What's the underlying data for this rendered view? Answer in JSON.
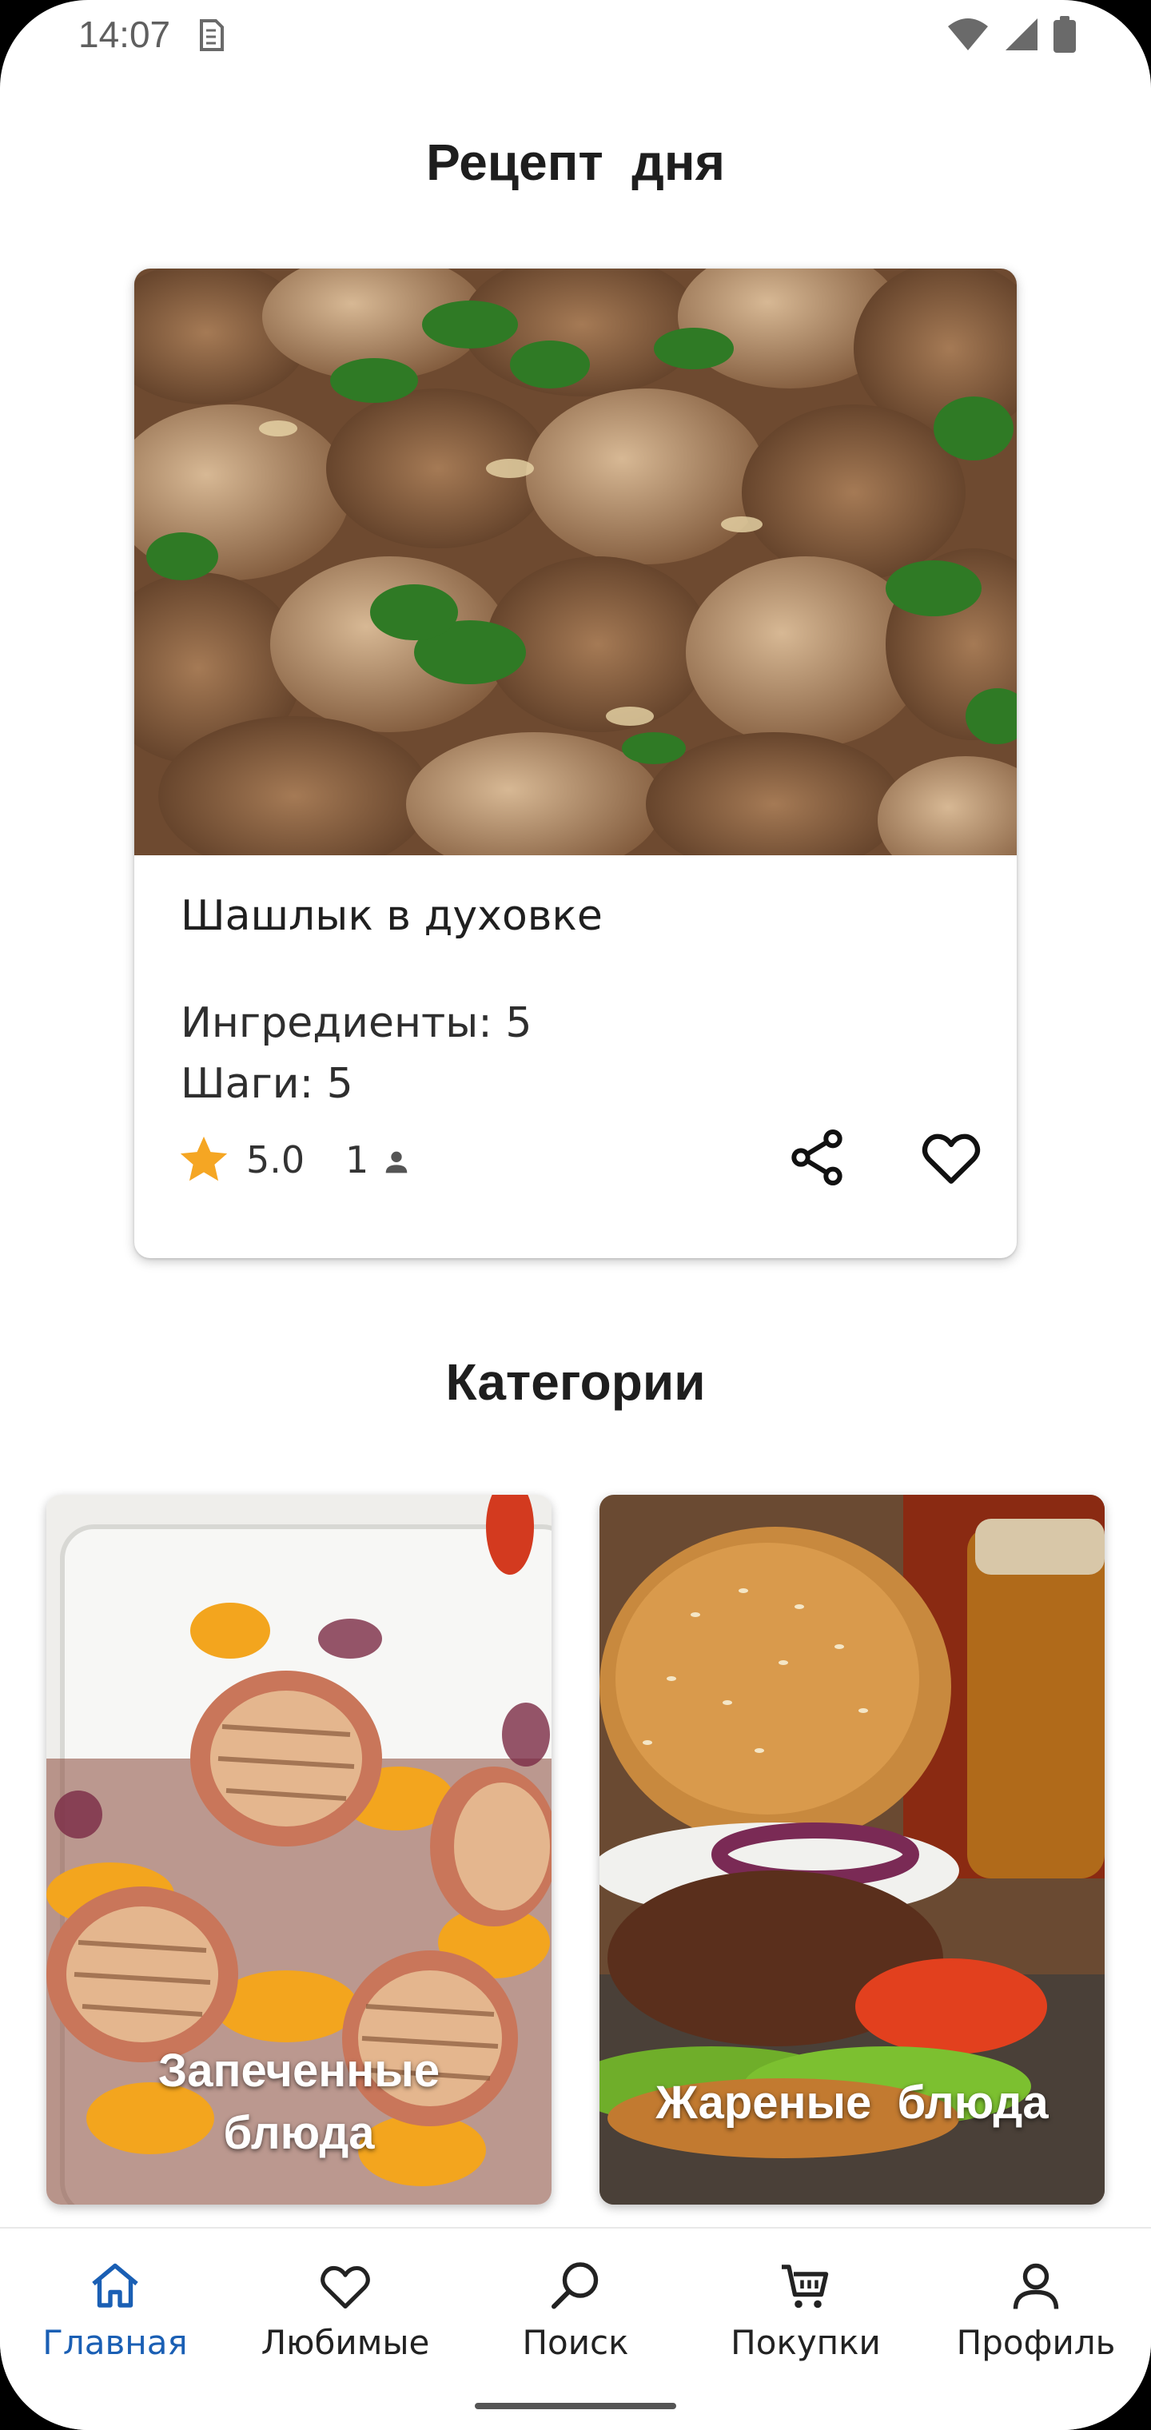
{
  "status_bar": {
    "time": "14:07"
  },
  "recipe_of_day": {
    "title": "Рецепт  дня",
    "name": "Шашлык в духовке",
    "ingredients": "Ингредиенты: 5",
    "steps": "Шаги: 5",
    "rating": "5.0",
    "voters": "1"
  },
  "categories": {
    "title": "Категории",
    "items": [
      {
        "label": "Запеченные\nблюда"
      },
      {
        "label": "Жареные  блюда"
      }
    ]
  },
  "bottom_nav": {
    "items": [
      {
        "label": "Главная",
        "icon": "home-icon",
        "active": true
      },
      {
        "label": "Любимые",
        "icon": "heart-icon"
      },
      {
        "label": "Поиск",
        "icon": "search-icon"
      },
      {
        "label": "Покупки",
        "icon": "cart-icon"
      },
      {
        "label": "Профиль",
        "icon": "person-icon"
      }
    ],
    "active_color": "#1a5fb4"
  },
  "colors": {
    "star": "#f5a623",
    "accent": "#1a5fb4"
  }
}
